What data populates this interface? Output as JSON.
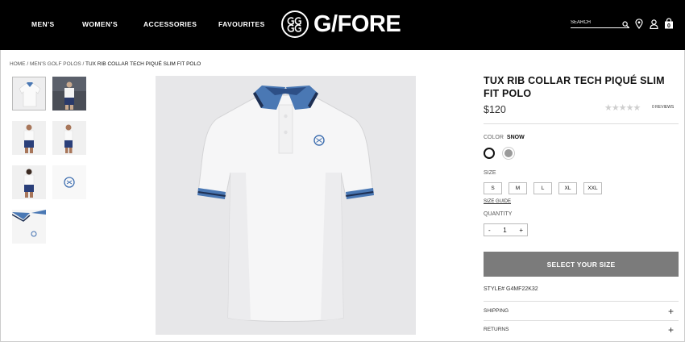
{
  "header": {
    "nav": [
      "MEN'S",
      "WOMEN'S",
      "ACCESSORIES",
      "FAVOURITES"
    ],
    "logo_text": "G/FORE",
    "search_placeholder": "SEARCH",
    "cart_count": "0"
  },
  "breadcrumb": {
    "home": "HOME",
    "category": "MEN'S GOLF POLOS",
    "current": "TUX RIB COLLAR TECH PIQUÉ SLIM FIT POLO",
    "sep": "/"
  },
  "product": {
    "title": "TUX RIB COLLAR TECH PIQUÉ SLIM FIT POLO",
    "price": "$120",
    "stars": "★★★★★",
    "reviews": "0 REVIEWS",
    "color_label": "COLOR",
    "color_value": "SNOW",
    "size_label": "SIZE",
    "sizes": [
      "S",
      "M",
      "L",
      "XL",
      "XXL"
    ],
    "size_guide": "SIZE GUIDE",
    "quantity_label": "QUANTITY",
    "quantity_minus": "-",
    "quantity_value": "1",
    "quantity_plus": "+",
    "cta": "SELECT YOUR SIZE",
    "style_number": "STYLE# G4MF22K32",
    "accordions": [
      {
        "label": "SHIPPING",
        "icon": "+"
      },
      {
        "label": "RETURNS",
        "icon": "+"
      }
    ]
  },
  "colors": {
    "brand_bg": "#000000",
    "collar_blue": "#4a78b4",
    "collar_navy": "#1e2f52",
    "cta_grey": "#7b7b7b"
  }
}
